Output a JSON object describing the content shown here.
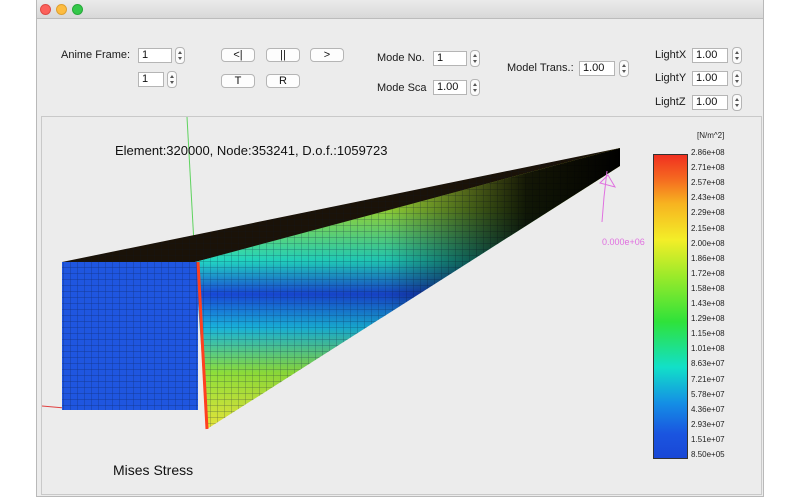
{
  "controls": {
    "anime_frame_label": "Anime Frame:",
    "anime_frame_value": "1",
    "second_frame_value": "1",
    "btn_prev": "<|",
    "btn_pause": "||",
    "btn_next": ">",
    "btn_t": "T",
    "btn_r": "R",
    "mode_no_label": "Mode No.",
    "mode_no_value": "1",
    "mode_sca_label": "Mode Sca",
    "mode_sca_value": "1.00",
    "model_trans_label": "Model Trans.:",
    "model_trans_value": "1.00",
    "lightx_label": "LightX",
    "lightx_value": "1.00",
    "lighty_label": "LightY",
    "lighty_value": "1.00",
    "lightz_label": "LightZ",
    "lightz_value": "1.00"
  },
  "viewport": {
    "info": "Element:320000, Node:353241, D.o.f.:1059723",
    "result_name": "Mises Stress",
    "load_label": "0.000e+06"
  },
  "colorbar": {
    "unit": "[N/m^2]",
    "ticks": [
      "2.86e+08",
      "2.71e+08",
      "2.57e+08",
      "2.43e+08",
      "2.29e+08",
      "2.15e+08",
      "2.00e+08",
      "1.86e+08",
      "1.72e+08",
      "1.58e+08",
      "1.43e+08",
      "1.29e+08",
      "1.15e+08",
      "1.01e+08",
      "8.63e+07",
      "7.21e+07",
      "5.78e+07",
      "4.36e+07",
      "2.93e+07",
      "1.51e+07",
      "8.50e+05"
    ]
  },
  "colors": {
    "high": "#f03020",
    "low": "#1947d6",
    "window_bg": "#ececec"
  }
}
